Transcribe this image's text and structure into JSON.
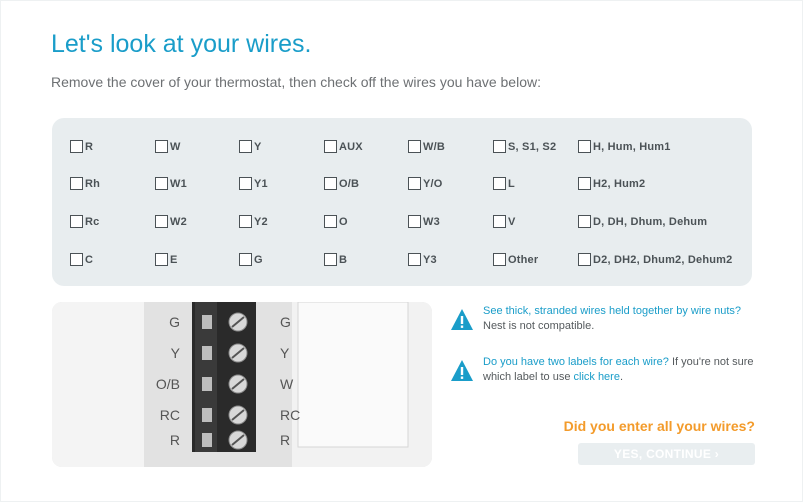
{
  "header": {
    "title": "Let's look at your wires.",
    "subtitle": "Remove the cover of your thermostat, then check off the wires you have below:"
  },
  "wires": [
    [
      "R",
      "W",
      "Y",
      "AUX",
      "W/B",
      "S, S1, S2",
      "H, Hum, Hum1"
    ],
    [
      "Rh",
      "W1",
      "Y1",
      "O/B",
      "Y/O",
      "L",
      "H2, Hum2"
    ],
    [
      "Rc",
      "W2",
      "Y2",
      "O",
      "W3",
      "V",
      "D, DH, Dhum, Dehum"
    ],
    [
      "C",
      "E",
      "G",
      "B",
      "Y3",
      "Other",
      "D2, DH2, Dhum2, Dehum2"
    ]
  ],
  "photo": {
    "left_labels": [
      "G",
      "Y",
      "O/B",
      "RC",
      "R"
    ],
    "right_labels": [
      "G",
      "Y",
      "W",
      "RC",
      "R"
    ]
  },
  "warnings": [
    {
      "icon": "warning-icon",
      "link_text": "See thick, stranded wires held together by wire nuts?",
      "text": " Nest is not compatible.",
      "link_text_2": "",
      "text_2": ""
    },
    {
      "icon": "warning-icon",
      "link_text": "Do you have two labels for each wire?",
      "text": " If you're not sure which label to use ",
      "link_text_2": "click here",
      "text_2": "."
    }
  ],
  "footer": {
    "question": "Did you enter all your wires?",
    "continue_label": "YES, CONTINUE ›"
  },
  "colors": {
    "accent_blue": "#1a9dc9",
    "accent_orange": "#f39b2b",
    "panel_bg": "#e8edef"
  }
}
